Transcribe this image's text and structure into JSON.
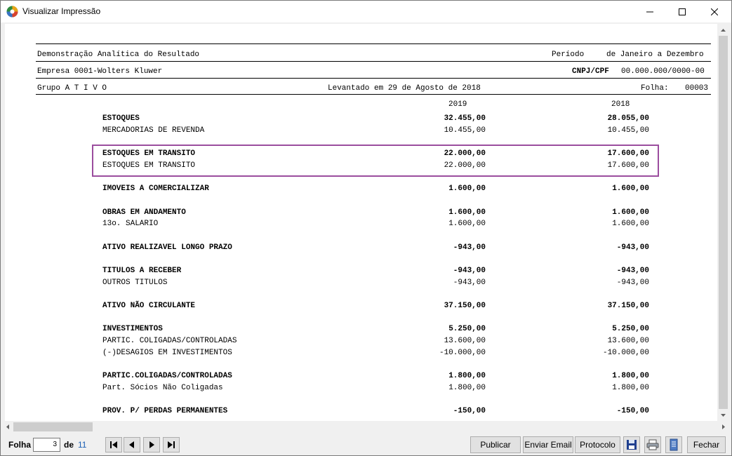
{
  "window": {
    "title": "Visualizar Impressão"
  },
  "report": {
    "header": {
      "title": "Demonstração Analítica do Resultado",
      "periodo_label": "Período",
      "periodo_value": "de Janeiro a Dezembro",
      "empresa": "Empresa 0001-Wolters Kluwer",
      "cnpj_label": "CNPJ/CPF",
      "cnpj_value": "00.000.000/0000-00",
      "grupo": "Grupo A T I V O",
      "levantado": "Levantado em 29 de Agosto de 2018",
      "folha_label": "Folha:",
      "folha_value": "00003"
    },
    "columns": [
      "2019",
      "2018"
    ],
    "rows": [
      {
        "label": "ESTOQUES",
        "v2019": "32.455,00",
        "v2018": "28.055,00",
        "bold": true
      },
      {
        "label": "MERCADORIAS DE REVENDA",
        "v2019": "10.455,00",
        "v2018": "10.455,00",
        "bold": false
      },
      {
        "label": "ESTOQUES EM TRANSITO",
        "v2019": "22.000,00",
        "v2018": "17.600,00",
        "bold": true
      },
      {
        "label": "ESTOQUES EM TRANSITO",
        "v2019": "22.000,00",
        "v2018": "17.600,00",
        "bold": false
      },
      {
        "label": "IMOVEIS A COMERCIALIZAR",
        "v2019": "1.600,00",
        "v2018": "1.600,00",
        "bold": true
      },
      {
        "label": "OBRAS EM ANDAMENTO",
        "v2019": "1.600,00",
        "v2018": "1.600,00",
        "bold": true
      },
      {
        "label": "13o. SALARIO",
        "v2019": "1.600,00",
        "v2018": "1.600,00",
        "bold": false
      },
      {
        "label": "ATIVO REALIZAVEL LONGO PRAZO",
        "v2019": "-943,00",
        "v2018": "-943,00",
        "bold": true
      },
      {
        "label": "TITULOS A RECEBER",
        "v2019": "-943,00",
        "v2018": "-943,00",
        "bold": true
      },
      {
        "label": "OUTROS TITULOS",
        "v2019": "-943,00",
        "v2018": "-943,00",
        "bold": false
      },
      {
        "label": "ATIVO NÃO CIRCULANTE",
        "v2019": "37.150,00",
        "v2018": "37.150,00",
        "bold": true
      },
      {
        "label": "INVESTIMENTOS",
        "v2019": "5.250,00",
        "v2018": "5.250,00",
        "bold": true
      },
      {
        "label": "PARTIC. COLIGADAS/CONTROLADAS",
        "v2019": "13.600,00",
        "v2018": "13.600,00",
        "bold": false
      },
      {
        "label": "(-)DESAGIOS EM INVESTIMENTOS",
        "v2019": "-10.000,00",
        "v2018": "-10.000,00",
        "bold": false
      },
      {
        "label": "PARTIC.COLIGADAS/CONTROLADAS",
        "v2019": "1.800,00",
        "v2018": "1.800,00",
        "bold": true
      },
      {
        "label": "Part. Sócios Não Coligadas",
        "v2019": "1.800,00",
        "v2018": "1.800,00",
        "bold": false
      },
      {
        "label": "PROV. P/ PERDAS PERMANENTES",
        "v2019": "-150,00",
        "v2018": "-150,00",
        "bold": true
      }
    ]
  },
  "toolbar": {
    "folha_label": "Folha",
    "folha_value": "3",
    "de_label": "de",
    "total_pages": "11",
    "publicar": "Publicar",
    "enviar_email": "Enviar Email",
    "protocolo": "Protocolo",
    "fechar": "Fechar"
  },
  "colors": {
    "highlight": "#9b4d9e",
    "page_count": "#1a5fb4"
  }
}
